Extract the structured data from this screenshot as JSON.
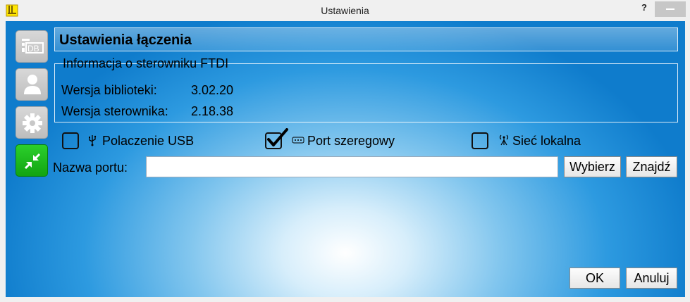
{
  "window": {
    "title": "Ustawienia",
    "help": "?"
  },
  "header": {
    "title": "Ustawienia łączenia"
  },
  "ftdi_info": {
    "legend": "Informacja o sterowniku FTDI",
    "library_label": "Wersja biblioteki:",
    "library_value": "3.02.20",
    "driver_label": "Wersja sterownika:",
    "driver_value": "2.18.38"
  },
  "connection": {
    "usb": {
      "label": "Polaczenie USB",
      "checked": false,
      "icon": "usb-icon"
    },
    "serial": {
      "label": "Port szeregowy",
      "checked": true,
      "icon": "serial-port-icon"
    },
    "lan": {
      "label": "Sieć lokalna",
      "checked": false,
      "icon": "antenna-icon"
    }
  },
  "port": {
    "label": "Nazwa portu:",
    "value": "",
    "choose_label": "Wybierz",
    "find_label": "Znajdź"
  },
  "footer": {
    "ok_label": "OK",
    "cancel_label": "Anuluj"
  },
  "sidebar": {
    "items": [
      {
        "icon": "database-icon",
        "active": false
      },
      {
        "icon": "user-icon",
        "active": false
      },
      {
        "icon": "gear-icon",
        "active": false
      },
      {
        "icon": "collapse-arrows-icon",
        "active": true
      }
    ]
  },
  "colors": {
    "accent_green": "#1bb81b",
    "background_blue": "#1a87d6"
  }
}
